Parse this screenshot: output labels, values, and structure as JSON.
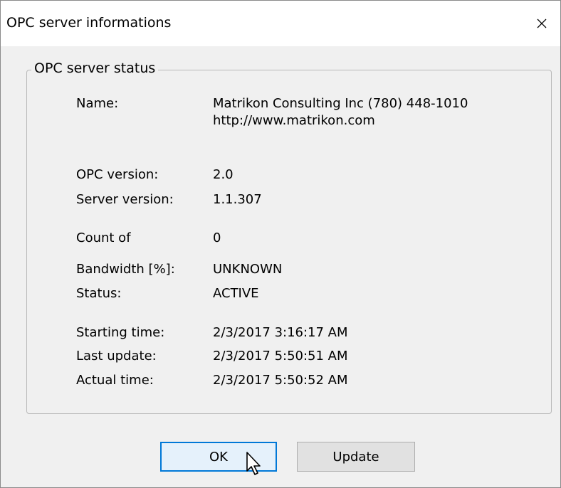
{
  "window": {
    "title": "OPC server informations",
    "close_icon": "close-icon"
  },
  "status_group": {
    "legend": "OPC server status",
    "rows": [
      {
        "label": "Name:",
        "value_line1": "Matrikon Consulting Inc (780) 448-1010",
        "value_line2": "http://www.matrikon.com"
      },
      {
        "label": "OPC version:",
        "value": "2.0"
      },
      {
        "label": "Server version:",
        "value": "1.1.307"
      },
      {
        "label": "Count of",
        "value": "0"
      },
      {
        "label": "Bandwidth [%]:",
        "value": "UNKNOWN"
      },
      {
        "label": "Status:",
        "value": "ACTIVE"
      },
      {
        "label": "Starting time:",
        "value": "2/3/2017 3:16:17 AM"
      },
      {
        "label": "Last update:",
        "value": "2/3/2017 5:50:51 AM"
      },
      {
        "label": "Actual time:",
        "value": "2/3/2017 5:50:52 AM"
      }
    ]
  },
  "buttons": {
    "ok_label": "OK",
    "update_label": "Update"
  },
  "colors": {
    "focus_border": "#0078d7",
    "dialog_bg": "#f0f0f0",
    "titlebar_bg": "#ffffff"
  }
}
